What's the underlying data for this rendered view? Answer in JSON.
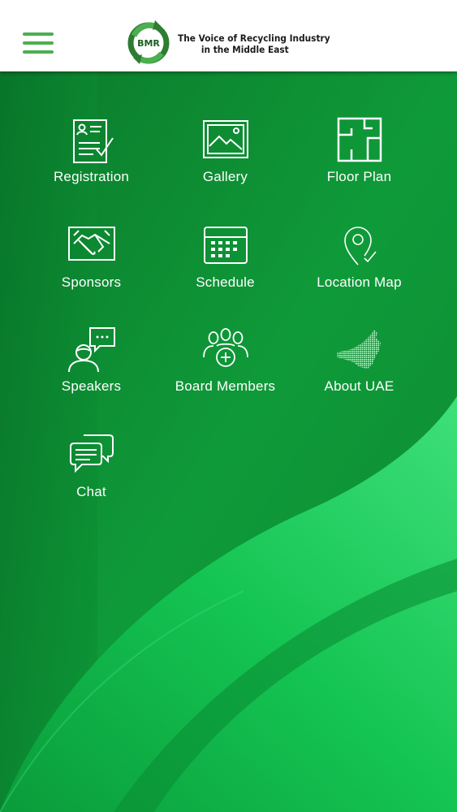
{
  "header": {
    "menu_icon": "hamburger-menu-icon",
    "logo": {
      "text": "BMR",
      "icon": "recycle-arrows-logo"
    },
    "tagline_line1": "The Voice of Recycling Industry",
    "tagline_line2": "in the Middle East"
  },
  "colors": {
    "accent": "#4caf50",
    "background_dark": "#0a7d2c",
    "background_light": "#2ed06a",
    "header": "#ffffff"
  },
  "menu": {
    "items": [
      {
        "label": "Registration",
        "icon": "registration-form-icon"
      },
      {
        "label": "Gallery",
        "icon": "gallery-picture-icon"
      },
      {
        "label": "Floor Plan",
        "icon": "floor-plan-icon"
      },
      {
        "label": "Sponsors",
        "icon": "handshake-icon"
      },
      {
        "label": "Schedule",
        "icon": "calendar-icon"
      },
      {
        "label": "Location Map",
        "icon": "map-pin-icon"
      },
      {
        "label": "Speakers",
        "icon": "speaker-chat-icon"
      },
      {
        "label": "Board Members",
        "icon": "group-people-icon"
      },
      {
        "label": "About UAE",
        "icon": "uae-map-icon"
      },
      {
        "label": "Chat",
        "icon": "chat-bubbles-icon"
      }
    ]
  }
}
